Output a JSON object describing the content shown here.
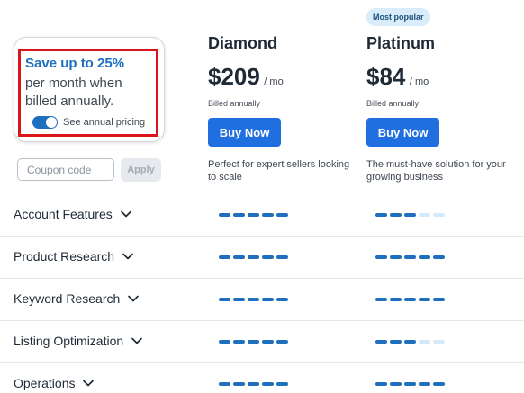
{
  "savings": {
    "title": "Save up to 25%",
    "description": "per month when billed annually.",
    "toggle_label": "See annual pricing",
    "toggle_on": true
  },
  "coupon": {
    "placeholder": "Coupon code",
    "value": "",
    "apply_label": "Apply"
  },
  "plans": [
    {
      "name": "Diamond",
      "badge": "",
      "price": "$209",
      "period": "/ mo",
      "billing": "Billed annually",
      "button_label": "Buy Now",
      "description": "Perfect for expert sellers looking to scale"
    },
    {
      "name": "Platinum",
      "badge": "Most popular",
      "price": "$84",
      "period": "/ mo",
      "billing": "Billed annually",
      "button_label": "Buy Now",
      "description": "The must-have solution for your growing business"
    }
  ],
  "features": [
    {
      "label": "Account Features",
      "levels": [
        5,
        3
      ]
    },
    {
      "label": "Product Research",
      "levels": [
        5,
        5
      ]
    },
    {
      "label": "Keyword Research",
      "levels": [
        5,
        5
      ]
    },
    {
      "label": "Listing Optimization",
      "levels": [
        5,
        3
      ]
    },
    {
      "label": "Operations",
      "levels": [
        5,
        5
      ]
    }
  ],
  "max_level": 5,
  "colors": {
    "accent": "#1f6fe0",
    "brand_blue": "#1f6fbf",
    "highlight_red": "#d9151b",
    "bar_inactive": "#d6e9f8"
  },
  "icons": {
    "feature_toggle": "chevron-down-icon"
  }
}
